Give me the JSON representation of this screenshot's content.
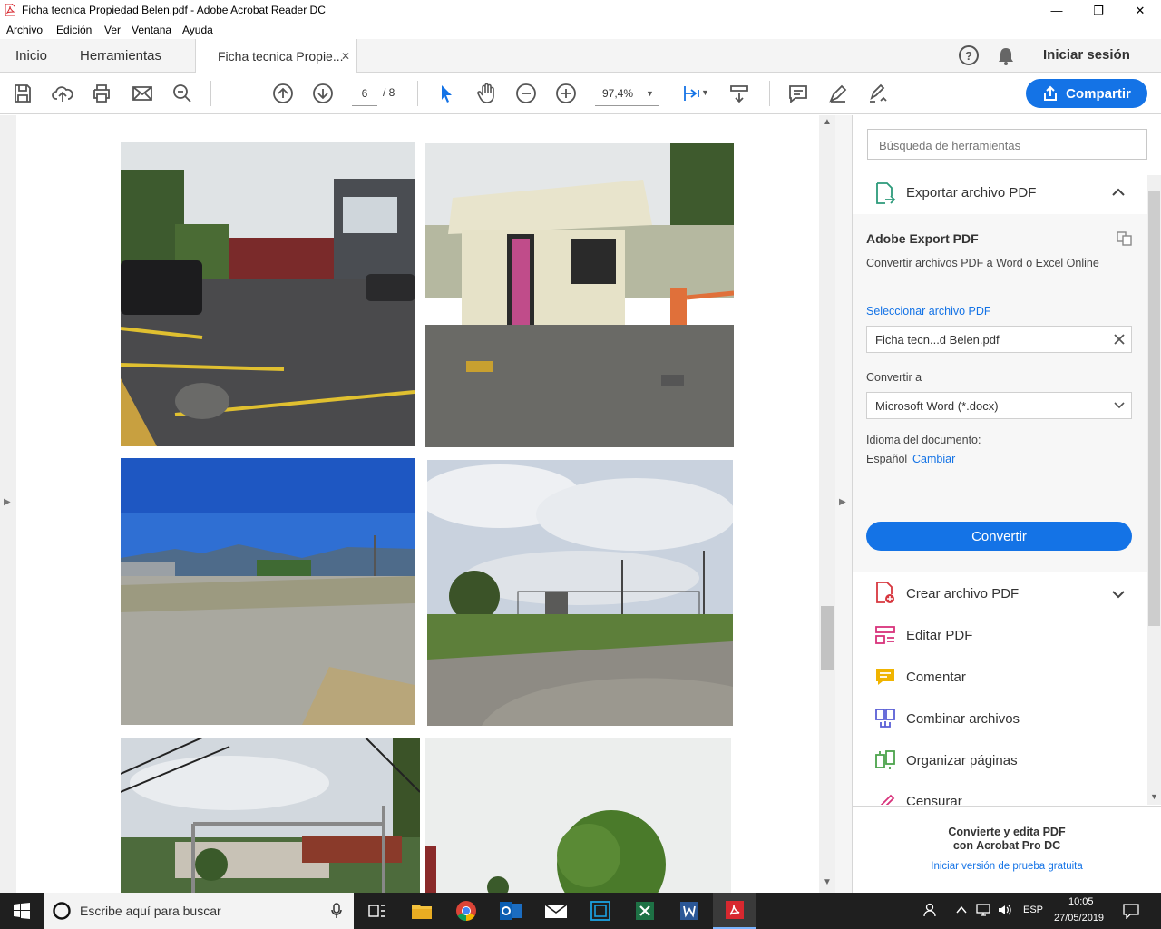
{
  "window": {
    "title": "Ficha tecnica Propiedad Belen.pdf - Adobe Acrobat Reader DC",
    "minimize": "—",
    "maximize": "❐",
    "close": "✕"
  },
  "menu": [
    "Archivo",
    "Edición",
    "Ver",
    "Ventana",
    "Ayuda"
  ],
  "tabs": {
    "home": "Inicio",
    "tools": "Herramientas",
    "document": "Ficha tecnica Propie...",
    "close": "✕"
  },
  "header": {
    "help": "?",
    "signin": "Iniciar sesión"
  },
  "toolbar": {
    "page_current": "6",
    "page_total": "/  8",
    "zoom": "97,4%",
    "share_label": "Compartir"
  },
  "tool_search": {
    "placeholder": "Búsqueda de herramientas"
  },
  "export_panel": {
    "section_title": "Exportar archivo PDF",
    "service_title": "Adobe Export PDF",
    "service_desc": "Convertir archivos PDF a Word o Excel Online",
    "select_file_label": "Seleccionar archivo PDF",
    "selected_file": "Ficha tecn...d Belen.pdf",
    "convert_to_label": "Convertir a",
    "convert_to_value": "Microsoft Word (*.docx)",
    "language_label": "Idioma del documento:",
    "language_value": "Español",
    "language_change": "Cambiar",
    "convert_button": "Convertir"
  },
  "tools_list": [
    {
      "label": "Crear archivo PDF",
      "icon": "create-pdf-icon"
    },
    {
      "label": "Editar PDF",
      "icon": "edit-pdf-icon"
    },
    {
      "label": "Comentar",
      "icon": "comment-icon"
    },
    {
      "label": "Combinar archivos",
      "icon": "combine-icon"
    },
    {
      "label": "Organizar páginas",
      "icon": "organize-icon"
    },
    {
      "label": "Censurar",
      "icon": "redact-icon"
    }
  ],
  "promo": {
    "line1": "Convierte y edita PDF",
    "line2": "con Acrobat Pro DC",
    "link": "Iniciar versión de prueba gratuita"
  },
  "taskbar": {
    "search_placeholder": "Escribe aquí para buscar",
    "lang": "ESP",
    "time": "10:05",
    "date": "27/05/2019"
  },
  "colors": {
    "accent": "#1473e6",
    "taskbar": "#1f1f1f"
  }
}
